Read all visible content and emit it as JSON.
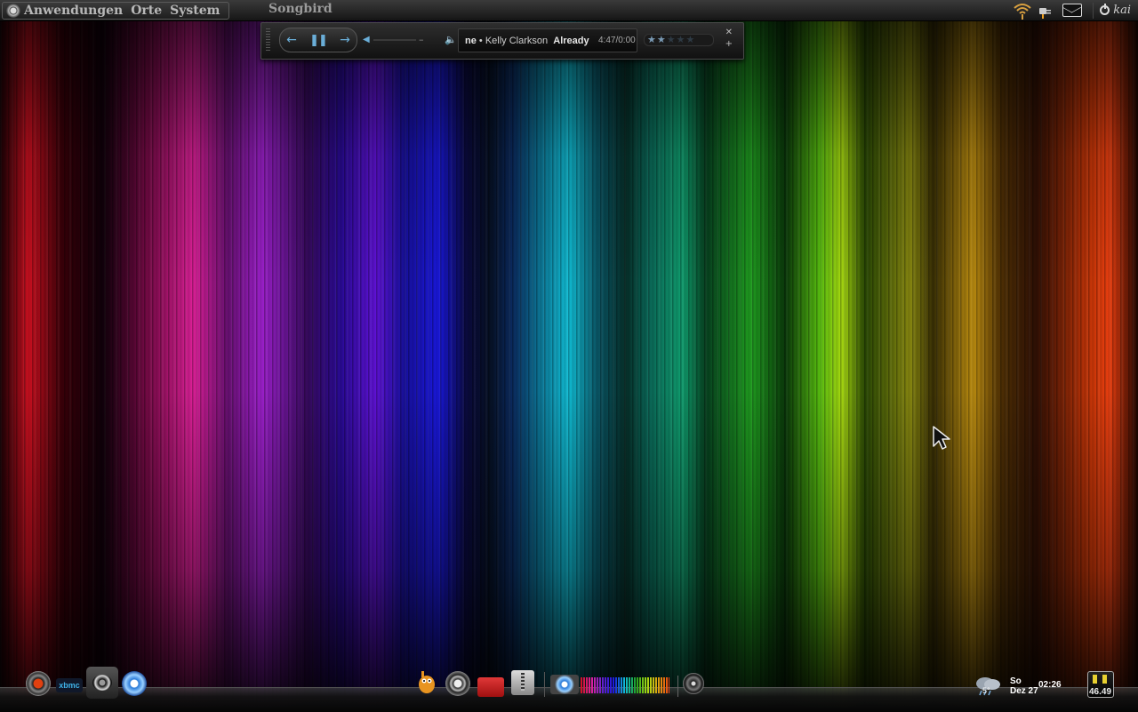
{
  "top_panel": {
    "menu": [
      "Anwendungen",
      "Orte",
      "System"
    ],
    "window_title": "Songbird",
    "user": "kai"
  },
  "player": {
    "scroll_prefix": "ne",
    "artist": "Kelly Clarkson",
    "title_partial": "Already",
    "time": "4:47/0:00",
    "rating": 2,
    "rating_max": 5
  },
  "dock": {
    "left_icons": [
      "ubuntu-tweak-icon",
      "xbmc-icon",
      "screenshot-camera-icon",
      "chromium-icon"
    ],
    "xbmc_label": "xbmc",
    "center_icons": [
      "gimp-icon",
      "system-settings-icon",
      "red-folder-icon",
      "archive-box-icon"
    ],
    "visualizer_icons": [
      "chromium-icon",
      "spectrum-visualizer-icon"
    ],
    "media_icon": "speaker-icon",
    "weather_temp": "5°",
    "clock_day": "So",
    "clock_date": "Dez 27",
    "clock_time": "02:26",
    "meter_value": "46.49"
  },
  "colors": {
    "panel_bg": "#1e1e1e",
    "player_accent": "#6aaed8",
    "menu_text": "#b8b8b8"
  }
}
